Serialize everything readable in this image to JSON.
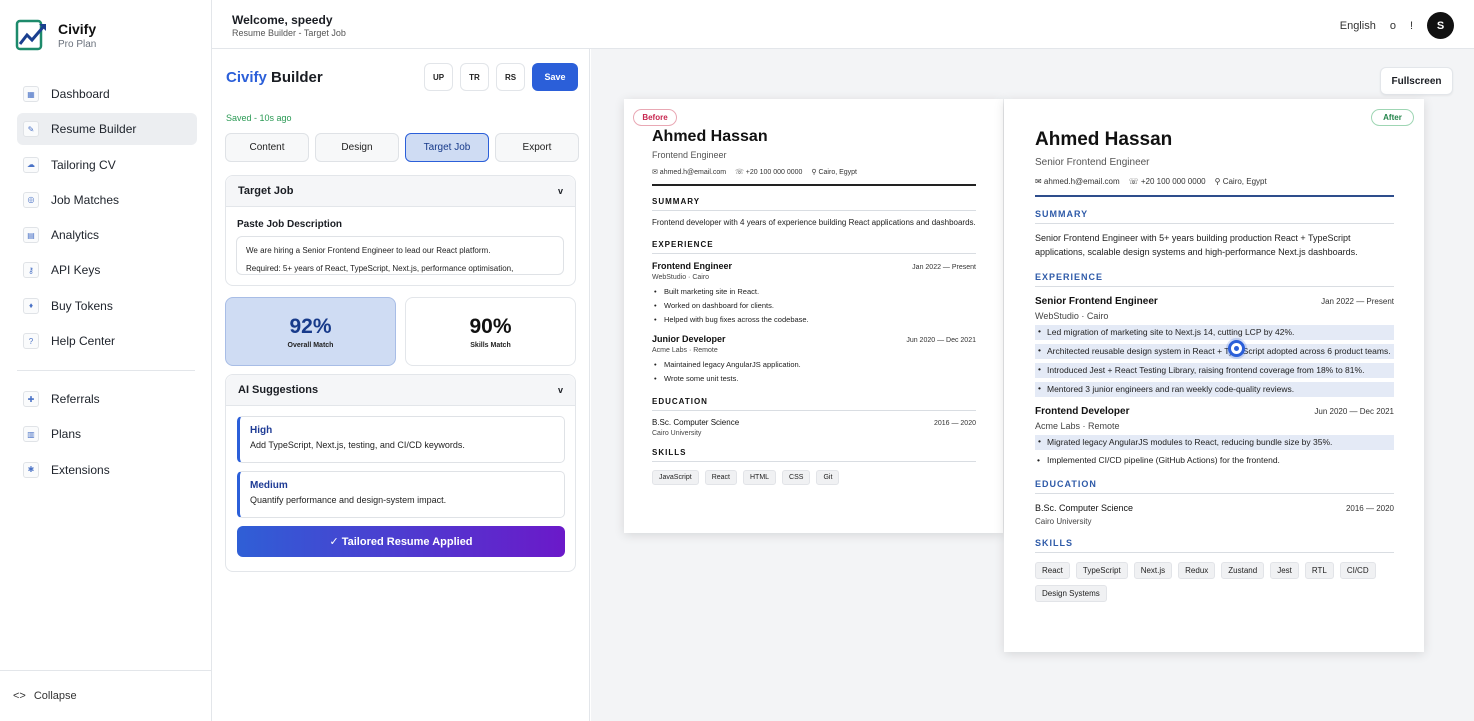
{
  "brand": {
    "name": "Civify",
    "plan": "Pro Plan"
  },
  "sidebar": {
    "items": [
      {
        "label": "Dashboard",
        "icon": "dashboard-icon",
        "glyph": "▦"
      },
      {
        "label": "Resume Builder",
        "icon": "resume-icon",
        "glyph": "✎"
      },
      {
        "label": "Tailoring CV",
        "icon": "tailoring-icon",
        "glyph": "☁"
      },
      {
        "label": "Job Matches",
        "icon": "target-icon",
        "glyph": "◎"
      },
      {
        "label": "Analytics",
        "icon": "analytics-icon",
        "glyph": "▤"
      },
      {
        "label": "API Keys",
        "icon": "key-icon",
        "glyph": "⚷"
      },
      {
        "label": "Buy Tokens",
        "icon": "token-icon",
        "glyph": "♦"
      },
      {
        "label": "Help Center",
        "icon": "help-icon",
        "glyph": "?"
      }
    ],
    "items2": [
      {
        "label": "Referrals",
        "icon": "gift-icon",
        "glyph": "✚"
      },
      {
        "label": "Plans",
        "icon": "plans-icon",
        "glyph": "▥"
      },
      {
        "label": "Extensions",
        "icon": "puzzle-icon",
        "glyph": "✱"
      }
    ],
    "collapse_icon": "<>",
    "collapse_label": "Collapse"
  },
  "header": {
    "welcome": "Welcome, speedy",
    "breadcrumb": "Resume Builder - Target Job",
    "language": "English",
    "theme_icon": "o",
    "alert_icon": "!",
    "avatar_initial": "S"
  },
  "builder": {
    "title_accent": "Civify",
    "title_rest": " Builder",
    "actions": [
      "UP",
      "TR",
      "RS"
    ],
    "save_label": "Save",
    "saved_status": "Saved - 10s ago",
    "tabs": [
      "Content",
      "Design",
      "Target Job",
      "Export"
    ],
    "target_job": {
      "heading": "Target Job",
      "chevron": "v",
      "paste_label": "Paste Job Description",
      "jd_line1": "We are hiring a Senior Frontend Engineer to lead our React platform.",
      "jd_line2": "Required: 5+ years of React, TypeScript, Next.js, performance optimisation,"
    },
    "scores": {
      "overall_value": "92%",
      "overall_label": "Overall Match",
      "skills_value": "90%",
      "skills_label": "Skills Match"
    },
    "suggestions": {
      "heading": "AI Suggestions",
      "chevron": "v",
      "items": [
        {
          "priority": "High",
          "text": "Add TypeScript, Next.js, testing, and CI/CD keywords."
        },
        {
          "priority": "Medium",
          "text": "Quantify performance and design-system impact."
        }
      ],
      "applied_label": "✓ Tailored Resume Applied"
    }
  },
  "preview": {
    "fullscreen_label": "Fullscreen",
    "before": {
      "tag": "Before",
      "name": "Ahmed Hassan",
      "role": "Frontend Engineer",
      "email": "✉ ahmed.h@email.com",
      "phone": "☏ +20 100 000 0000",
      "location": "⚲ Cairo, Egypt",
      "summary_title": "SUMMARY",
      "summary": "Frontend developer with 4 years of experience building React applications and dashboards.",
      "experience_title": "EXPERIENCE",
      "job1_title": "Frontend Engineer",
      "job1_date": "Jan 2022 — Present",
      "job1_company": "WebStudio · Cairo",
      "job1_bullets": [
        "Built marketing site in React.",
        "Worked on dashboard for clients.",
        "Helped with bug fixes across the codebase."
      ],
      "job2_title": "Junior Developer",
      "job2_date": "Jun 2020 — Dec 2021",
      "job2_company": "Acme Labs · Remote",
      "job2_bullets": [
        "Maintained legacy AngularJS application.",
        "Wrote some unit tests."
      ],
      "education_title": "EDUCATION",
      "degree": "B.Sc. Computer Science",
      "degree_date": "2016 — 2020",
      "school": "Cairo University",
      "skills_title": "SKILLS",
      "skills": [
        "JavaScript",
        "React",
        "HTML",
        "CSS",
        "Git"
      ]
    },
    "after": {
      "tag": "After",
      "name": "Ahmed Hassan",
      "role": "Senior Frontend Engineer",
      "email": "✉ ahmed.h@email.com",
      "phone": "☏ +20 100 000 0000",
      "location": "⚲ Cairo, Egypt",
      "summary_title": "SUMMARY",
      "summary": "Senior Frontend Engineer with 5+ years building production React + TypeScript applications, scalable design systems and high-performance Next.js dashboards.",
      "experience_title": "EXPERIENCE",
      "job1_title": "Senior Frontend Engineer",
      "job1_date": "Jan 2022 — Present",
      "job1_company": "WebStudio · Cairo",
      "job1_bullets": [
        "Led migration of marketing site to Next.js 14, cutting LCP by 42%.",
        "Architected reusable design system in React + TypeScript adopted across 6 product teams.",
        "Introduced Jest + React Testing Library, raising frontend coverage from 18% to 81%.",
        "Mentored 3 junior engineers and ran weekly code-quality reviews."
      ],
      "job2_title": "Frontend Developer",
      "job2_date": "Jun 2020 — Dec 2021",
      "job2_company": "Acme Labs · Remote",
      "job2_bullets": [
        "Migrated legacy AngularJS modules to React, reducing bundle size by 35%.",
        "Implemented CI/CD pipeline (GitHub Actions) for the frontend."
      ],
      "education_title": "EDUCATION",
      "degree": "B.Sc. Computer Science",
      "degree_date": "2016 — 2020",
      "school": "Cairo University",
      "skills_title": "SKILLS",
      "skills": [
        "React",
        "TypeScript",
        "Next.js",
        "Redux",
        "Zustand",
        "Jest",
        "RTL",
        "CI/CD",
        "Design Systems"
      ]
    }
  },
  "colors": {
    "accent": "#2b5fd9",
    "saved": "#2b9a55",
    "gradient_start": "#2f5fd6",
    "gradient_end": "#6b19c9"
  }
}
